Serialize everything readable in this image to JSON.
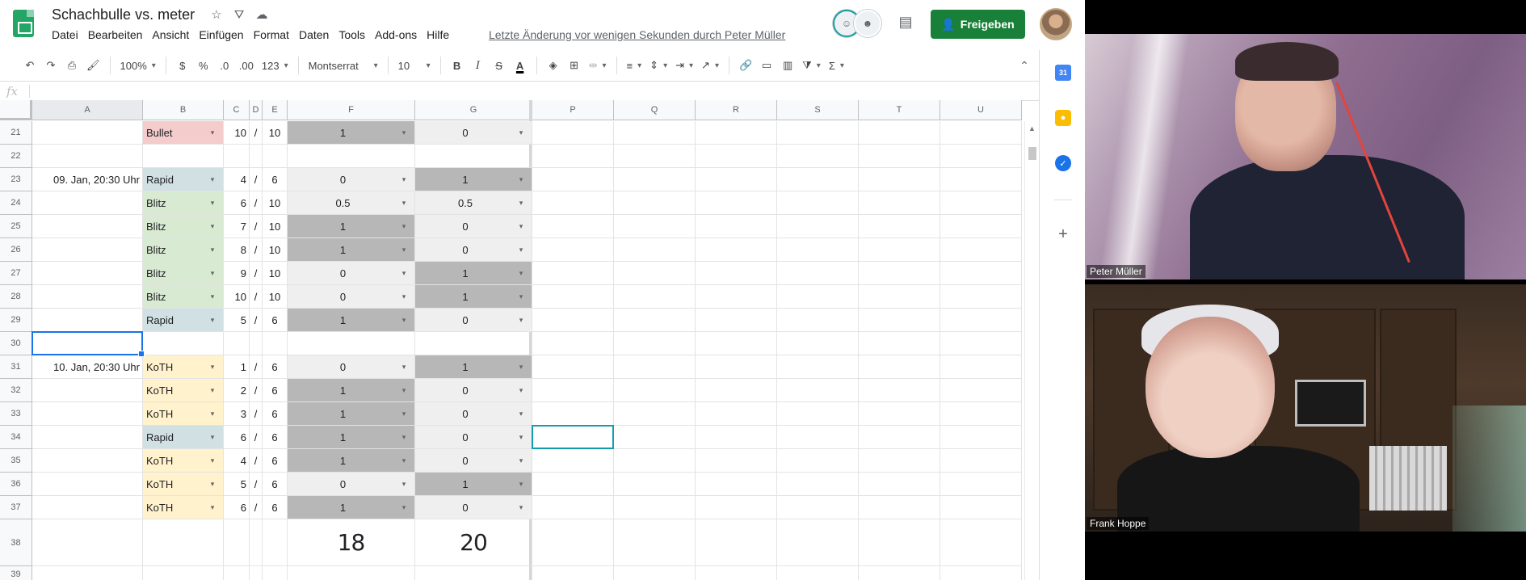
{
  "doc": {
    "title": "Schachbulle vs. meter",
    "last_edit": "Letzte Änderung vor wenigen Sekunden durch Peter Müller",
    "share_label": "Freigeben"
  },
  "menus": [
    "Datei",
    "Bearbeiten",
    "Ansicht",
    "Einfügen",
    "Format",
    "Daten",
    "Tools",
    "Add-ons",
    "Hilfe"
  ],
  "toolbar": {
    "zoom": "100%",
    "currency": "$",
    "percent": "%",
    "dec_less": ".0",
    "dec_more": ".00",
    "format_more": "123",
    "font": "Montserrat",
    "font_size": "10",
    "bold": "B",
    "italic": "I",
    "strike": "S",
    "text_color": "A"
  },
  "formula_bar": {
    "fx": "fx",
    "value": ""
  },
  "columns": [
    "A",
    "B",
    "C",
    "D",
    "E",
    "F",
    "G",
    "P",
    "Q",
    "R",
    "S",
    "T",
    "U"
  ],
  "rows": [
    {
      "n": "21",
      "a": "",
      "type": "Bullet",
      "c": "10",
      "d": "/",
      "e": "10",
      "f": "1",
      "g": "0"
    },
    {
      "n": "22",
      "a": "",
      "type": "",
      "c": "",
      "d": "",
      "e": "",
      "f": "",
      "g": ""
    },
    {
      "n": "23",
      "a": "09. Jan, 20:30 Uhr",
      "type": "Rapid",
      "c": "4",
      "d": "/",
      "e": "6",
      "f": "0",
      "g": "1"
    },
    {
      "n": "24",
      "a": "",
      "type": "Blitz",
      "c": "6",
      "d": "/",
      "e": "10",
      "f": "0.5",
      "g": "0.5"
    },
    {
      "n": "25",
      "a": "",
      "type": "Blitz",
      "c": "7",
      "d": "/",
      "e": "10",
      "f": "1",
      "g": "0"
    },
    {
      "n": "26",
      "a": "",
      "type": "Blitz",
      "c": "8",
      "d": "/",
      "e": "10",
      "f": "1",
      "g": "0"
    },
    {
      "n": "27",
      "a": "",
      "type": "Blitz",
      "c": "9",
      "d": "/",
      "e": "10",
      "f": "0",
      "g": "1"
    },
    {
      "n": "28",
      "a": "",
      "type": "Blitz",
      "c": "10",
      "d": "/",
      "e": "10",
      "f": "0",
      "g": "1"
    },
    {
      "n": "29",
      "a": "",
      "type": "Rapid",
      "c": "5",
      "d": "/",
      "e": "6",
      "f": "1",
      "g": "0"
    },
    {
      "n": "30",
      "a": "",
      "type": "",
      "c": "",
      "d": "",
      "e": "",
      "f": "",
      "g": ""
    },
    {
      "n": "31",
      "a": "10. Jan, 20:30 Uhr",
      "type": "KoTH",
      "c": "1",
      "d": "/",
      "e": "6",
      "f": "0",
      "g": "1"
    },
    {
      "n": "32",
      "a": "",
      "type": "KoTH",
      "c": "2",
      "d": "/",
      "e": "6",
      "f": "1",
      "g": "0"
    },
    {
      "n": "33",
      "a": "",
      "type": "KoTH",
      "c": "3",
      "d": "/",
      "e": "6",
      "f": "1",
      "g": "0"
    },
    {
      "n": "34",
      "a": "",
      "type": "Rapid",
      "c": "6",
      "d": "/",
      "e": "6",
      "f": "1",
      "g": "0"
    },
    {
      "n": "35",
      "a": "",
      "type": "KoTH",
      "c": "4",
      "d": "/",
      "e": "6",
      "f": "1",
      "g": "0"
    },
    {
      "n": "36",
      "a": "",
      "type": "KoTH",
      "c": "5",
      "d": "/",
      "e": "6",
      "f": "0",
      "g": "1"
    },
    {
      "n": "37",
      "a": "",
      "type": "KoTH",
      "c": "6",
      "d": "/",
      "e": "6",
      "f": "1",
      "g": "0"
    },
    {
      "n": "38",
      "a": "",
      "type": "",
      "c": "",
      "d": "",
      "e": "",
      "f": "18",
      "g": "20",
      "total": true
    },
    {
      "n": "39",
      "a": "",
      "type": "",
      "c": "",
      "d": "",
      "e": "",
      "f": "",
      "g": ""
    }
  ],
  "type_colors": {
    "Bullet": "#f4cccc",
    "Rapid": "#d0e0e3",
    "Blitz": "#d9ead3",
    "KoTH": "#fff2cc"
  },
  "score_colors": {
    "win": "#b7b7b7",
    "loss": "#efefef"
  },
  "participants": [
    {
      "name": "Peter Müller"
    },
    {
      "name": "Frank Hoppe"
    }
  ],
  "sidebar": {
    "calendar_label": "31"
  }
}
